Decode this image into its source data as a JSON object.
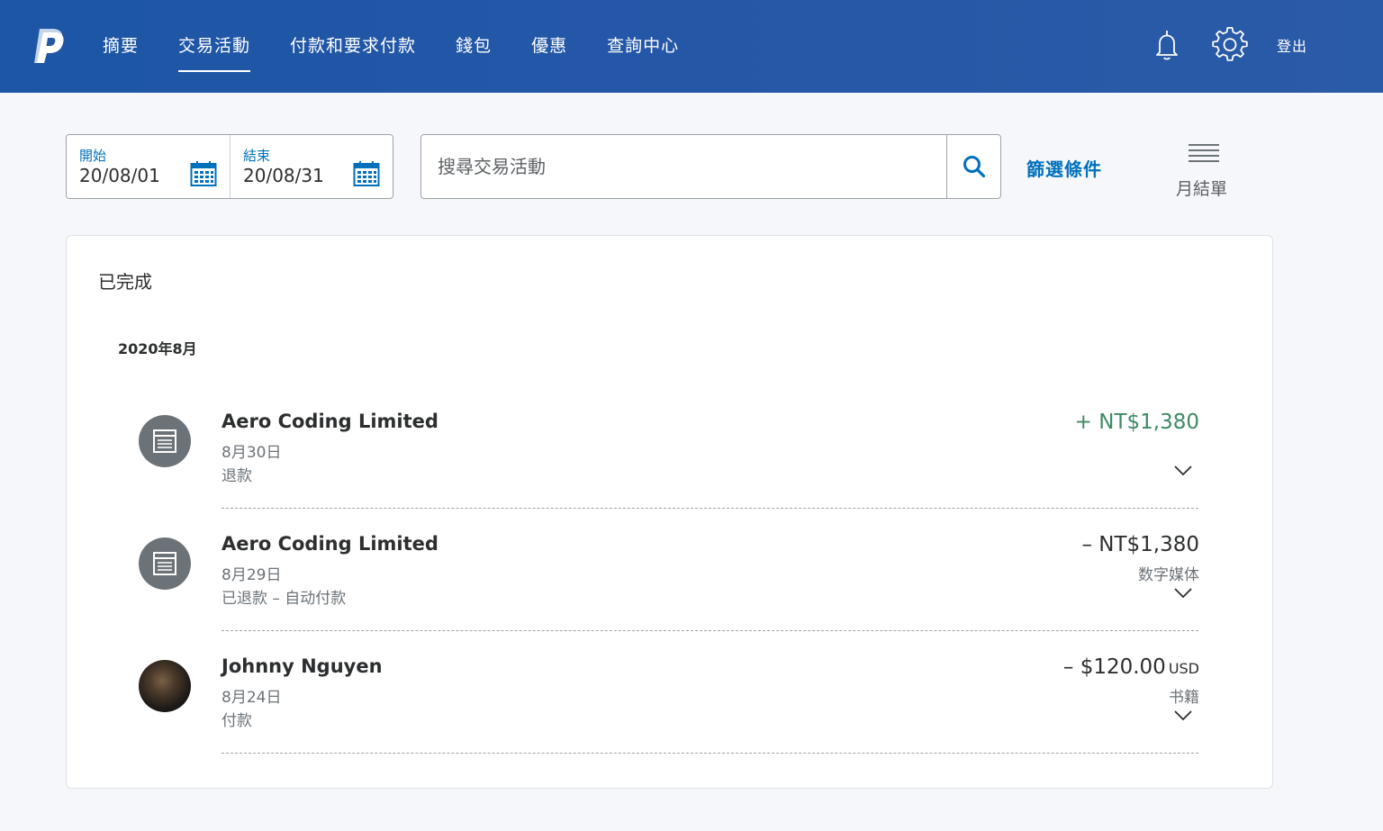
{
  "header": {
    "nav": [
      "摘要",
      "交易活動",
      "付款和要求付款",
      "錢包",
      "優惠",
      "查詢中心"
    ],
    "active_index": 1,
    "logout_label": "登出",
    "brand_color": "#2557a7"
  },
  "filters": {
    "start_label": "開始",
    "start_value": "20/08/01",
    "end_label": "結束",
    "end_value": "20/08/31",
    "search_placeholder": "搜尋交易活動",
    "filter_link": "篩選條件",
    "statements_label": "月結單"
  },
  "activity": {
    "section_title": "已完成",
    "month": "2020年8月",
    "transactions": [
      {
        "name": "Aero Coding Limited",
        "date": "8月30日",
        "status": "退款",
        "amount": "+ NT$1,380",
        "currency": "",
        "category": "",
        "avatar": "store-icon",
        "amount_color": "#3e8a64"
      },
      {
        "name": "Aero Coding Limited",
        "date": "8月29日",
        "status": "已退款 – 自动付款",
        "amount": "– NT$1,380",
        "currency": "",
        "category": "数字媒体",
        "avatar": "store-icon",
        "amount_color": "#2c2e2f"
      },
      {
        "name": "Johnny Nguyen",
        "date": "8月24日",
        "status": "付款",
        "amount": "– $120.00",
        "currency": "USD",
        "category": "书籍",
        "avatar": "profile-photo",
        "amount_color": "#2c2e2f"
      }
    ]
  }
}
